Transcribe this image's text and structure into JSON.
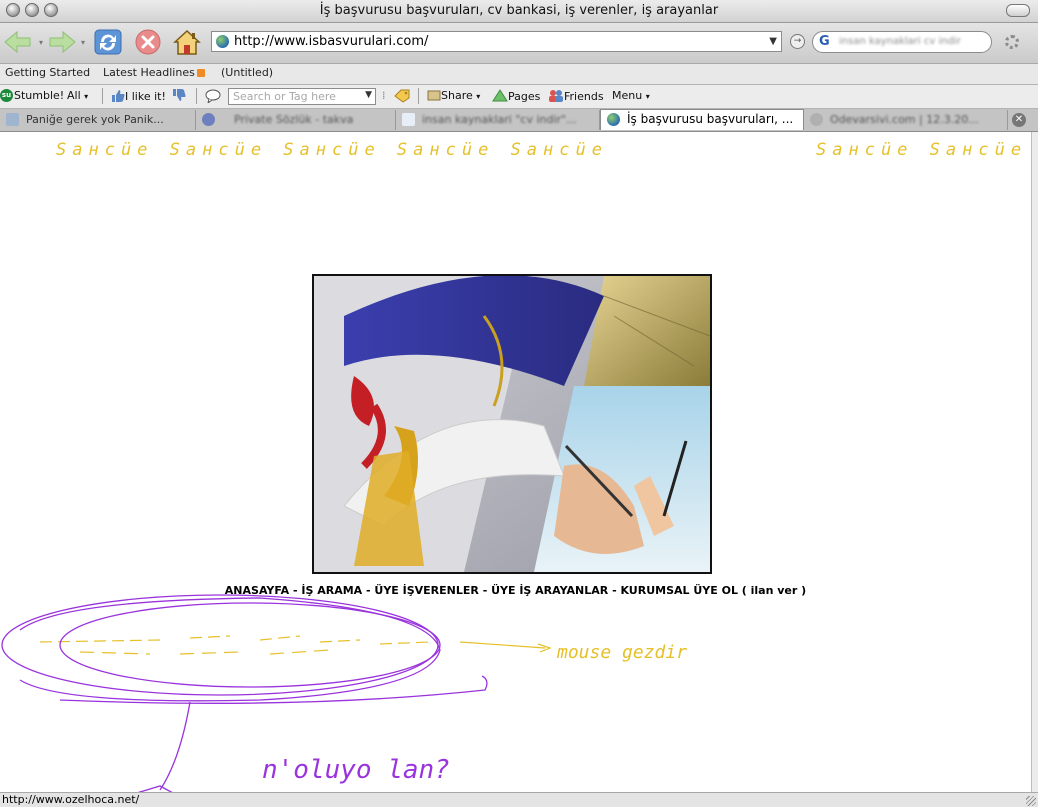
{
  "window": {
    "title": "İş başvurusu başvuruları, cv bankasi, iş verenler, iş arayanlar"
  },
  "nav": {
    "back_icon": "back-arrow-icon",
    "forward_icon": "forward-arrow-icon",
    "reload_icon": "reload-icon",
    "stop_icon": "stop-icon",
    "home_icon": "home-icon",
    "url": "http://www.isbasvurulari.com/",
    "search_text": "insan kaynaklari cv indir"
  },
  "bookmarks": {
    "items": [
      "Getting Started",
      "Latest Headlines",
      "(Untitled)"
    ]
  },
  "stumble": {
    "stumble_label": "Stumble!",
    "all_label": "All",
    "like_label": "I like it!",
    "search_placeholder": "Search or Tag here",
    "share_label": "Share",
    "pages_label": "Pages",
    "friends_label": "Friends",
    "menu_label": "Menu"
  },
  "tabs": [
    {
      "label": "Paniğe gerek yok Panik...",
      "active": false
    },
    {
      "label": "Private Sözlük - takva",
      "active": false
    },
    {
      "label": "insan kaynaklari \"cv indir\"...",
      "active": false
    },
    {
      "label": "İş başvurusu başvuruları, ...",
      "active": true
    },
    {
      "label": "Odevarsivi.com | 12.3.20...",
      "active": false
    }
  ],
  "content": {
    "scribble_left": "Sансüе  Sансüе  Sансüе Sансüе Sансüе",
    "scribble_right": "Sансüе Sансüе",
    "menu_line": "ANASAYFA - İŞ ARAMA - ÜYE İŞVERENLER - ÜYE İŞ ARAYANLAR - KURUMSAL ÜYE OL ( ilan ver )",
    "annotation_mouse": "mouse gezdir",
    "annotation_question": "n'oluyo lan?"
  },
  "status": {
    "text": "http://www.ozelhoca.net/"
  },
  "colors": {
    "scribble_yellow": "#e6c02a",
    "scribble_purple": "#9933dd"
  }
}
